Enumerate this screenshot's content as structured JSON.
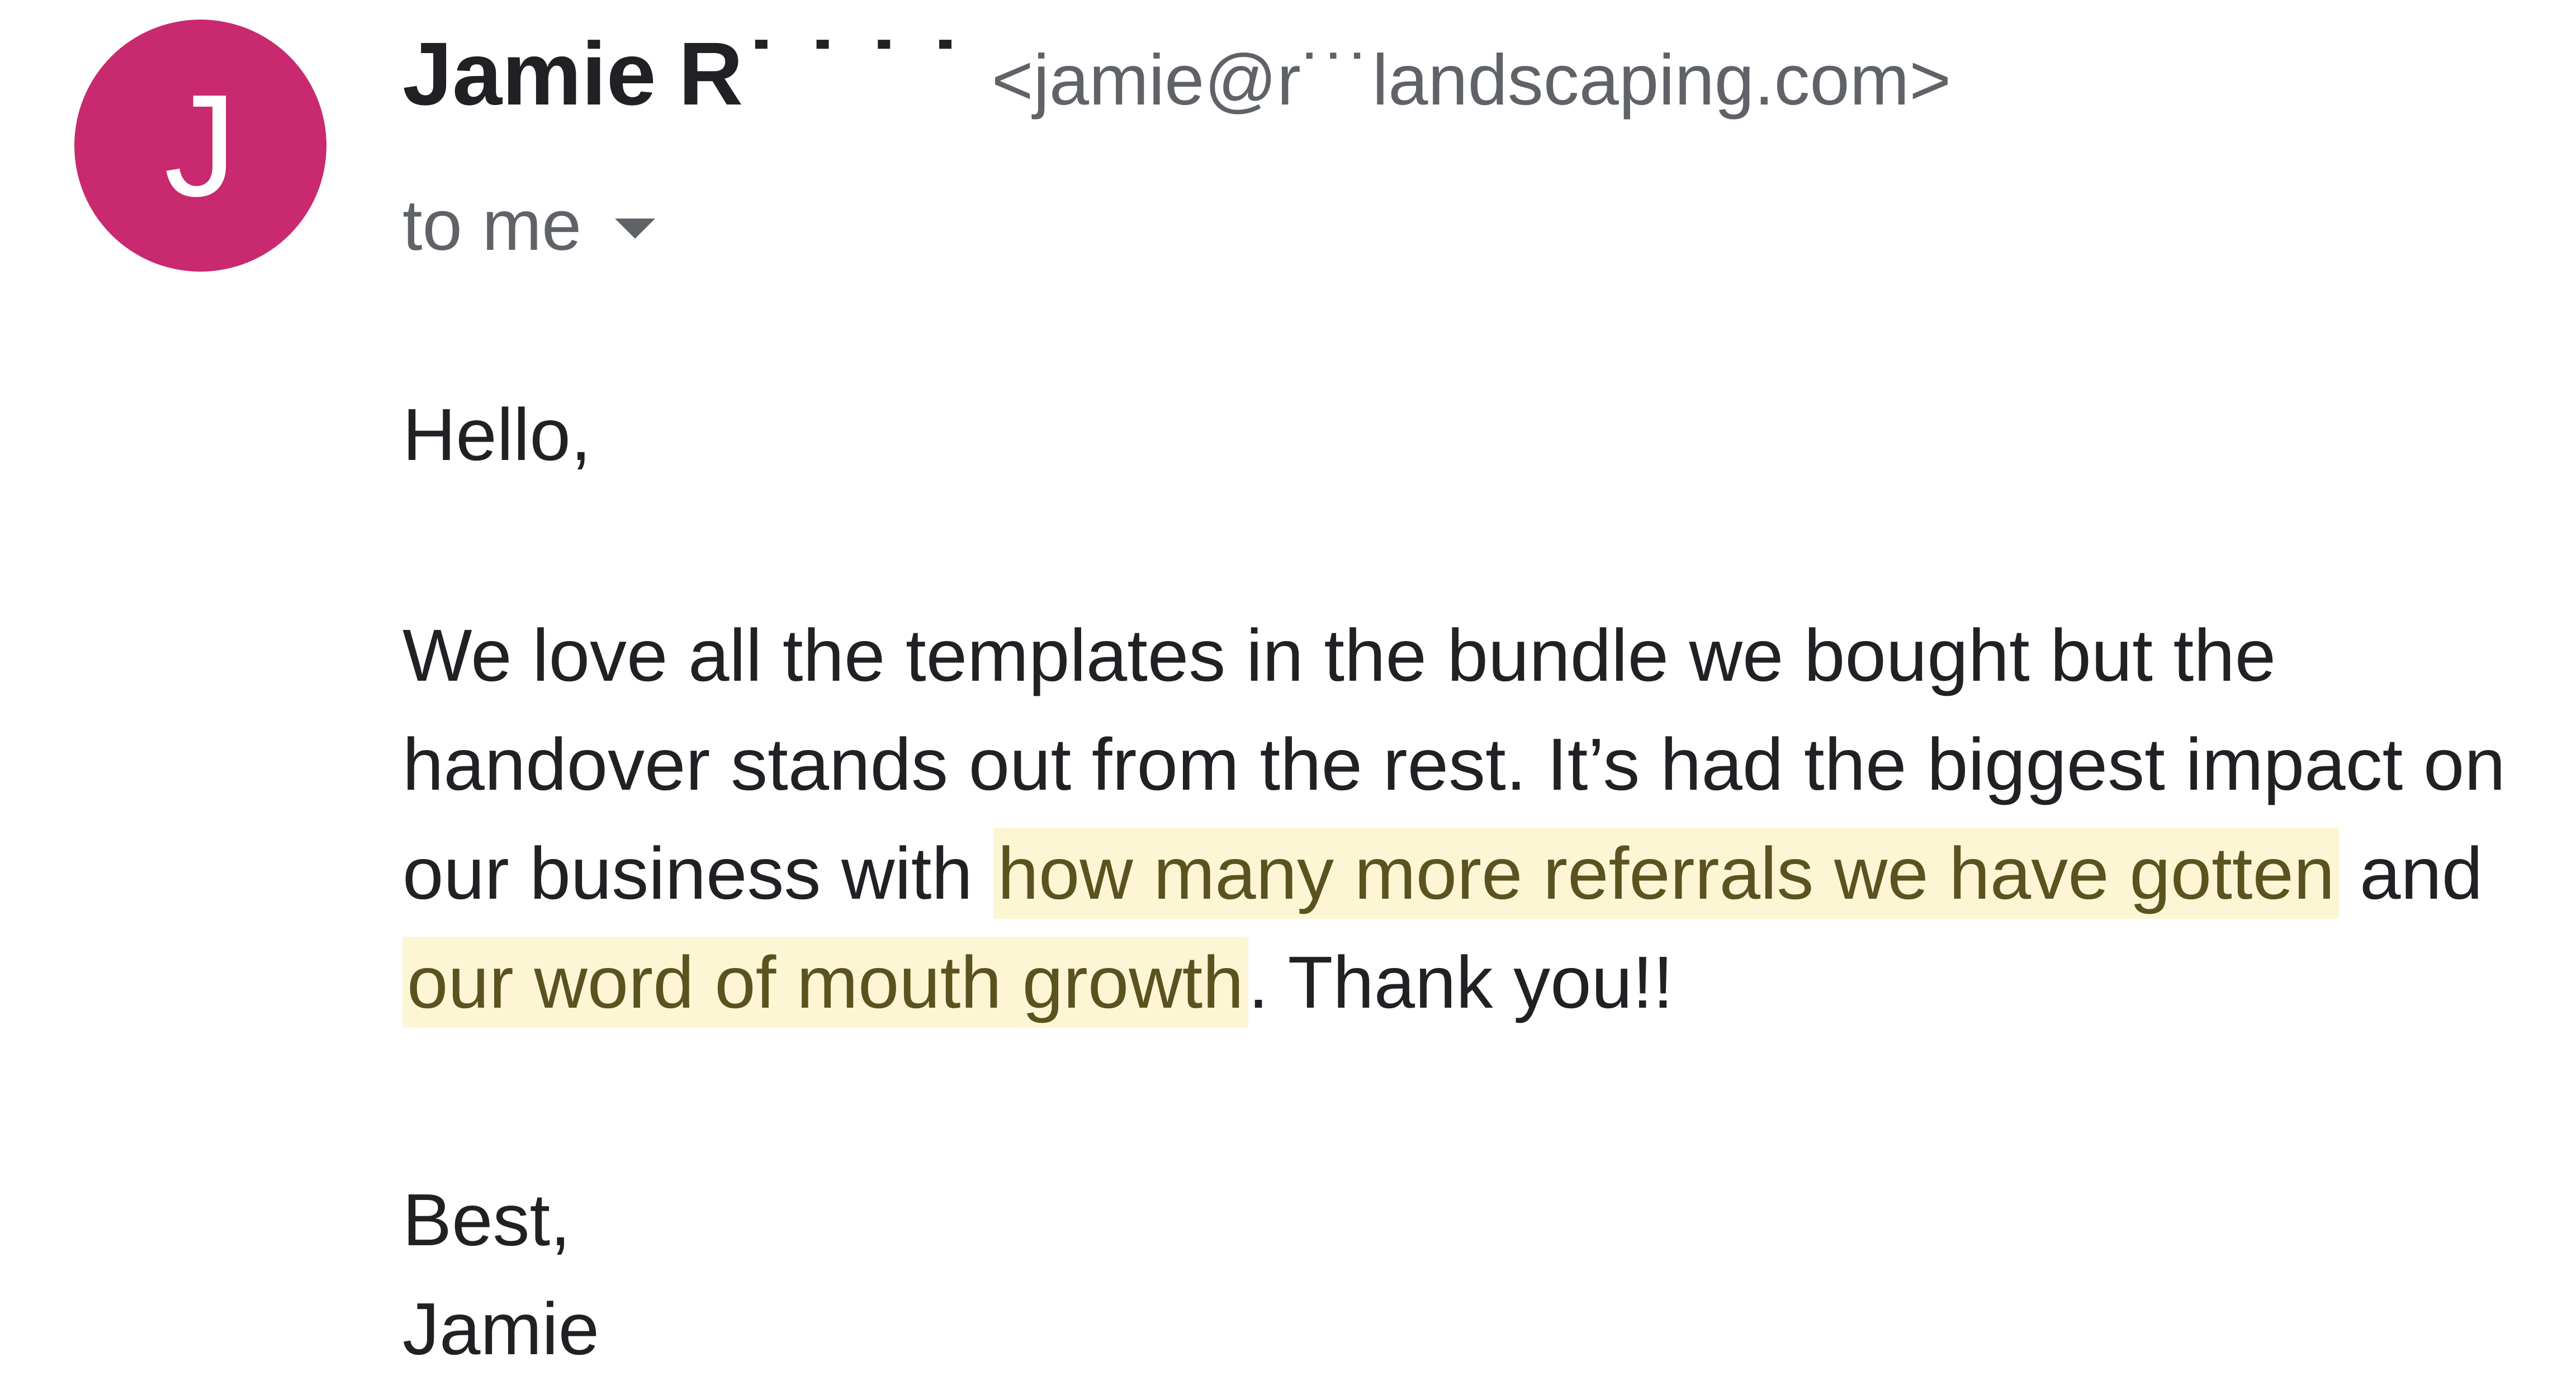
{
  "avatar": {
    "letter": "J",
    "color": "#c9296e"
  },
  "sender": {
    "name_first": "Jamie",
    "name_last_partial": "R˙ ˙ ˙ ˙",
    "email": "<jamie@r˙˙˙landscaping.com>"
  },
  "recipient": {
    "label": "to me"
  },
  "message": {
    "greeting": "Hello,",
    "paragraph_part1": "We love all the templates in the bundle we bought but the handover stands out from the rest. It’s had the biggest impact on our business with ",
    "highlight1": "how many more referrals we have gotten",
    "paragraph_part2": " and ",
    "highlight2": "our word of mouth growth",
    "paragraph_part3": ". Thank you!!",
    "signoff": "Best,",
    "signature": "Jamie"
  },
  "colors": {
    "highlight_bg": "#fdf6d4",
    "highlight_text": "#5a5320",
    "secondary_text": "#5f6368"
  }
}
